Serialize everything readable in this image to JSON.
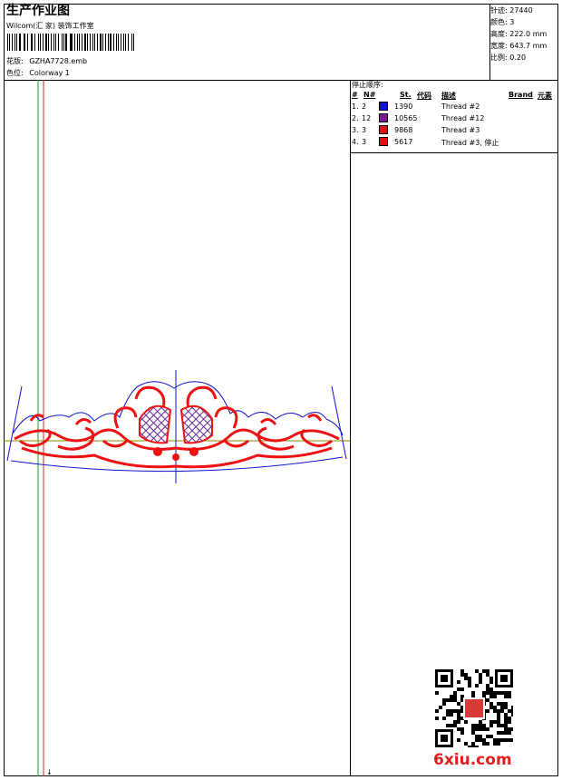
{
  "header": {
    "title": "生产作业图",
    "studio": "Wilcom(汇 家) 装饰工作室",
    "design_file_label": "花版:",
    "design_file": "GZHA7728.emb",
    "colorway_label": "色位:",
    "colorway": "Colorway 1"
  },
  "stats": {
    "stitches": "针迹: 27440",
    "colors": "颜色: 3",
    "height": "高度: 222.0 mm",
    "width": "宽度: 643.7 mm",
    "scale": "比例: 0.20"
  },
  "sequence": {
    "title": "停止顺序:",
    "columns": [
      "#",
      "N#",
      "St.",
      "代码",
      "描述",
      "Brand",
      "元素"
    ],
    "rows": [
      {
        "index": "1.",
        "n": "2",
        "code": "1390",
        "desc": "Thread #2",
        "color": "#1010e0"
      },
      {
        "index": "2.",
        "n": "12",
        "code": "10565",
        "desc": "Thread #12",
        "color": "#7a1a8c"
      },
      {
        "index": "3.",
        "n": "3",
        "code": "9868",
        "desc": "Thread #3",
        "color": "#e01010"
      },
      {
        "index": "4.",
        "n": "3",
        "code": "5617",
        "desc": "Thread #3, 停止",
        "color": "#e01010"
      }
    ]
  },
  "canvas": {
    "bottom_marker": "↓"
  },
  "watermark": "6xiu.com",
  "colors": {
    "guide_green": "#19a319",
    "guide_red": "#e02020",
    "outline_blue": "#1010d0",
    "fill_red": "#ee1111",
    "fill_purple": "#6a2a9a",
    "baseline": "#8a8a00"
  }
}
